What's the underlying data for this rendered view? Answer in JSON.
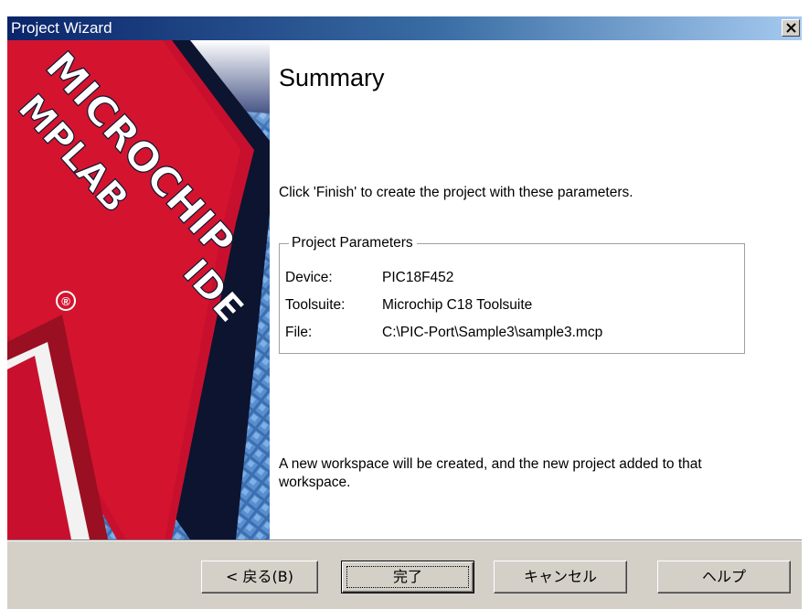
{
  "window": {
    "title": "Project Wizard"
  },
  "banner": {
    "brand_text": "MICROCHIP",
    "product_text": "MPLAB",
    "ide_text": "IDE",
    "registered_mark": "®"
  },
  "content": {
    "heading": "Summary",
    "instruction": "Click 'Finish' to create the project with these parameters.",
    "group_title": "Project Parameters",
    "parameters": [
      {
        "key": "Device:",
        "value": "PIC18F452"
      },
      {
        "key": "Toolsuite:",
        "value": "Microchip C18 Toolsuite"
      },
      {
        "key": "File:",
        "value": "C:\\PIC-Port\\Sample3\\sample3.mcp"
      }
    ],
    "note": "A new workspace will be created, and the new project added to that workspace."
  },
  "buttons": {
    "back": "< 戻る(B)",
    "finish": "完了",
    "cancel": "キャンセル",
    "help": "ヘルプ"
  },
  "colors": {
    "titlebar_start": "#0a246a",
    "titlebar_end": "#a6caf0",
    "dialog_face": "#d4d0c8",
    "banner_red": "#c8102e",
    "banner_blue": "#1d2f6b"
  }
}
